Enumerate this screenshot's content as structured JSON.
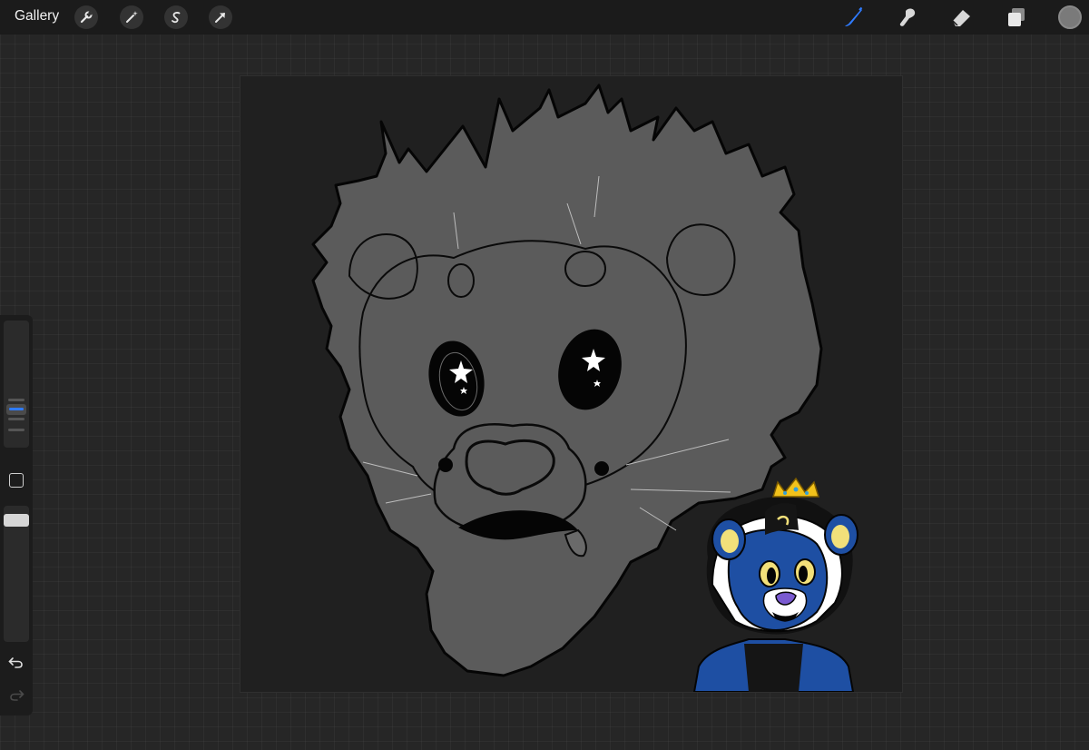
{
  "toolbar": {
    "gallery_label": "Gallery",
    "left_tools": [
      "wrench-icon",
      "magic-wand-icon",
      "selection-s-icon",
      "transform-arrow-icon"
    ],
    "right_tools": [
      "brush-icon",
      "smudge-icon",
      "eraser-icon",
      "layers-icon"
    ],
    "active_tool": "brush-icon",
    "active_color": "#2f7bff",
    "current_color": "#7a7a7a"
  },
  "sidebar": {
    "controls": [
      "brush-size-slider",
      "modify-square-button",
      "opacity-slider",
      "undo-icon",
      "redo-icon"
    ],
    "accent_color": "#2f7bff"
  },
  "canvas": {
    "background_color": "#202020",
    "lion_fill_color": "#5b5b5b",
    "sticker_fur_color": "#1e4fa3"
  }
}
